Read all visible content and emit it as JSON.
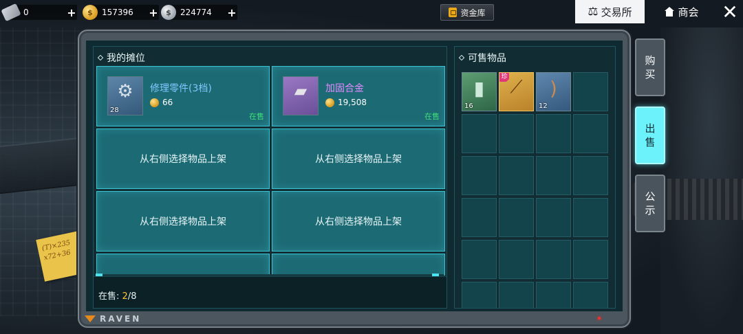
{
  "topbar": {
    "currencies": [
      {
        "icon": "ticket-icon",
        "value": "0"
      },
      {
        "icon": "gold-coin-icon",
        "value": "157396"
      },
      {
        "icon": "silver-coin-icon",
        "value": "224774"
      }
    ],
    "plus_label": "+",
    "vault_label": "资金库",
    "exchange_label": "交易所",
    "guild_label": "商会",
    "close_label": "✕"
  },
  "stall": {
    "title": "我的摊位",
    "items": [
      {
        "name": "修理零件(3档)",
        "qty": "28",
        "price": "66",
        "status": "在售",
        "rarity_color": "#7fc8ff"
      },
      {
        "name": "加固合金",
        "qty": "",
        "price": "19,508",
        "status": "在售",
        "rarity_color": "#e28cff"
      }
    ],
    "empty_slot_text": "从右侧选择物品上架",
    "on_sale_label": "在售:",
    "on_sale_count": "2",
    "on_sale_total": "/8"
  },
  "sellable": {
    "title": "可售物品",
    "items": [
      {
        "qty": "16",
        "rare": ""
      },
      {
        "qty": "",
        "rare": "珍"
      },
      {
        "qty": "12",
        "rare": ""
      }
    ]
  },
  "side_tabs": {
    "buy": [
      "购",
      "买"
    ],
    "sell": [
      "出",
      "售"
    ],
    "notice": [
      "公",
      "示"
    ]
  },
  "footer": {
    "brand": "RAVEN"
  },
  "note": {
    "line1": "(T)×235",
    "line2": "x72+36"
  },
  "colors": {
    "accent_cyan": "#6cf2fb",
    "slot_teal": "#1c6a74",
    "on_sale_green": "#3ee07a",
    "count_yellow": "#ffc23c"
  }
}
